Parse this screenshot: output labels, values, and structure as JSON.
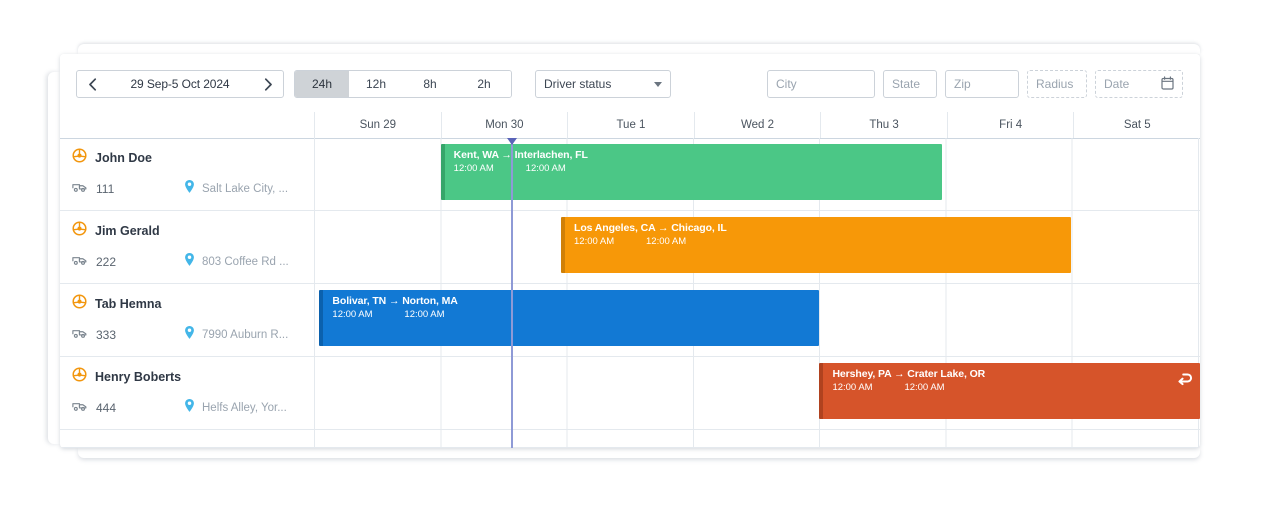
{
  "toolbar": {
    "date_range": "29 Sep-5 Oct 2024",
    "prev_label": "‹",
    "next_label": "›",
    "zoom_levels": [
      {
        "label": "24h",
        "active": true
      },
      {
        "label": "12h",
        "active": false
      },
      {
        "label": "8h",
        "active": false
      },
      {
        "label": "2h",
        "active": false
      }
    ],
    "driver_status": {
      "label": "Driver status"
    },
    "city": {
      "placeholder": "City",
      "value": ""
    },
    "state": {
      "placeholder": "State",
      "value": ""
    },
    "zip": {
      "placeholder": "Zip",
      "value": ""
    },
    "radius": {
      "placeholder": "Radius",
      "value": "",
      "disabled": true
    },
    "date": {
      "placeholder": "Date",
      "value": "",
      "disabled": true
    }
  },
  "grid": {
    "days": [
      "Sun 29",
      "Mon 30",
      "Tue 1",
      "Wed 2",
      "Thu 3",
      "Fri 4",
      "Sat 5"
    ],
    "now_marker_percent": 22.1
  },
  "drivers": [
    {
      "name": "John Doe",
      "unit": "111",
      "location": "Salt Lake City, ...",
      "trip": {
        "title": "Kent, WA → Interlachen, FL",
        "start_time": "12:00 AM",
        "end_time": "12:00 AM",
        "color": "#4bc786",
        "accent": "#35a56a",
        "left_percent": 14.2,
        "width_percent": 56.7,
        "has_return_icon": false
      }
    },
    {
      "name": "Jim Gerald",
      "unit": "222",
      "location": "803 Coffee Rd ...",
      "trip": {
        "title": "Los Angeles, CA → Chicago, IL",
        "start_time": "12:00 AM",
        "end_time": "12:00 AM",
        "color": "#f79808",
        "accent": "#d08007",
        "left_percent": 27.8,
        "width_percent": 57.6,
        "has_return_icon": false
      }
    },
    {
      "name": "Tab Hemna",
      "unit": "333",
      "location": "7990 Auburn R...",
      "trip": {
        "title": "Bolivar, TN → Norton, MA",
        "start_time": "12:00 AM",
        "end_time": "12:00 AM",
        "color": "#1279d4",
        "accent": "#0b61ad",
        "left_percent": 0.5,
        "width_percent": 56.5,
        "has_return_icon": false
      }
    },
    {
      "name": "Henry Boberts",
      "unit": "444",
      "location": "Helfs Alley, Yor...",
      "trip": {
        "title": "Hershey, PA → Crater Lake, OR",
        "start_time": "12:00 AM",
        "end_time": "12:00 AM",
        "color": "#d6542a",
        "accent": "#b0421f",
        "left_percent": 57.0,
        "width_percent": 43.0,
        "has_return_icon": true
      }
    }
  ],
  "icons": {
    "steering_wheel": "steering-wheel-icon",
    "truck": "truck-icon",
    "map_pin": "map-pin-icon",
    "calendar": "calendar-icon",
    "return_arrow": "return-arrow-icon"
  }
}
